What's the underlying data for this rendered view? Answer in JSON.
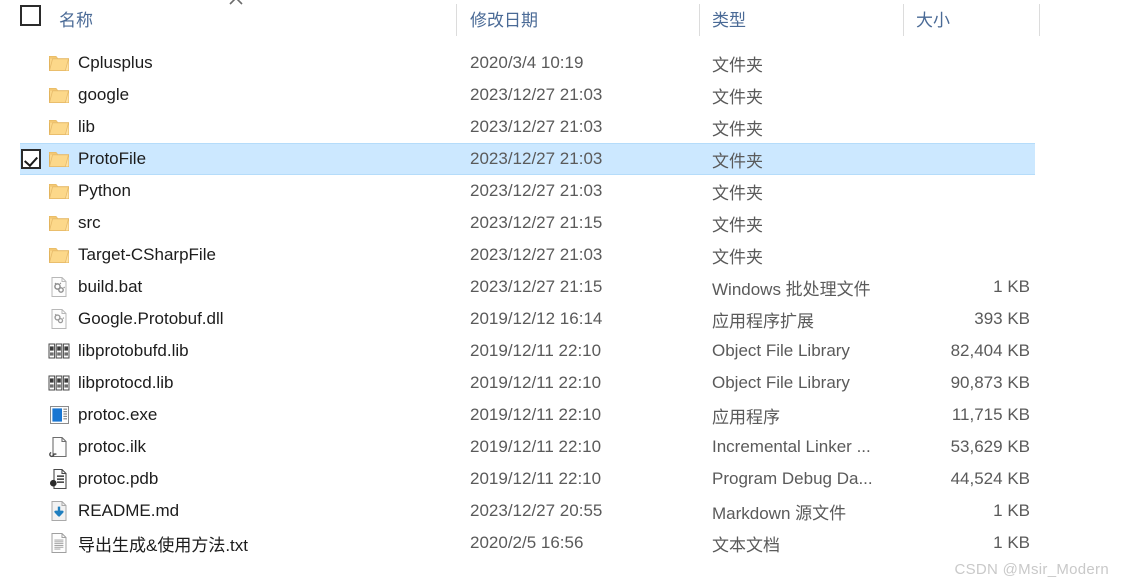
{
  "header": {
    "select_all_checkbox": false,
    "sort_indicator": "chevron-up-icon",
    "columns": [
      {
        "key": "name",
        "label": "名称"
      },
      {
        "key": "date",
        "label": "修改日期"
      },
      {
        "key": "type",
        "label": "类型"
      },
      {
        "key": "size",
        "label": "大小"
      }
    ]
  },
  "colors": {
    "selection_fill": "#cce8ff",
    "selection_border": "#b5dcfa",
    "header_text": "#4a6a96",
    "folder": "#f7d08a",
    "watermark": "#c9c9c9"
  },
  "rows": [
    {
      "name": "Cplusplus",
      "date": "2020/3/4 10:19",
      "type": "文件夹",
      "size": "",
      "icon": "folder-icon",
      "selected": false,
      "checked": false
    },
    {
      "name": "google",
      "date": "2023/12/27 21:03",
      "type": "文件夹",
      "size": "",
      "icon": "folder-icon",
      "selected": false,
      "checked": false
    },
    {
      "name": "lib",
      "date": "2023/12/27 21:03",
      "type": "文件夹",
      "size": "",
      "icon": "folder-icon",
      "selected": false,
      "checked": false
    },
    {
      "name": "ProtoFile",
      "date": "2023/12/27 21:03",
      "type": "文件夹",
      "size": "",
      "icon": "folder-icon",
      "selected": true,
      "checked": true
    },
    {
      "name": "Python",
      "date": "2023/12/27 21:03",
      "type": "文件夹",
      "size": "",
      "icon": "folder-icon",
      "selected": false,
      "checked": false
    },
    {
      "name": "src",
      "date": "2023/12/27 21:15",
      "type": "文件夹",
      "size": "",
      "icon": "folder-icon",
      "selected": false,
      "checked": false
    },
    {
      "name": "Target-CSharpFile",
      "date": "2023/12/27 21:03",
      "type": "文件夹",
      "size": "",
      "icon": "folder-icon",
      "selected": false,
      "checked": false
    },
    {
      "name": "build.bat",
      "date": "2023/12/27 21:15",
      "type": "Windows 批处理文件",
      "size": "1 KB",
      "icon": "batch-file-icon",
      "selected": false,
      "checked": false
    },
    {
      "name": "Google.Protobuf.dll",
      "date": "2019/12/12 16:14",
      "type": "应用程序扩展",
      "size": "393 KB",
      "icon": "dll-file-icon",
      "selected": false,
      "checked": false
    },
    {
      "name": "libprotobufd.lib",
      "date": "2019/12/11 22:10",
      "type": "Object File Library",
      "size": "82,404 KB",
      "icon": "library-file-icon",
      "selected": false,
      "checked": false
    },
    {
      "name": "libprotocd.lib",
      "date": "2019/12/11 22:10",
      "type": "Object File Library",
      "size": "90,873 KB",
      "icon": "library-file-icon",
      "selected": false,
      "checked": false
    },
    {
      "name": "protoc.exe",
      "date": "2019/12/11 22:10",
      "type": "应用程序",
      "size": "11,715 KB",
      "icon": "application-icon",
      "selected": false,
      "checked": false
    },
    {
      "name": "protoc.ilk",
      "date": "2019/12/11 22:10",
      "type": "Incremental Linker ...",
      "size": "53,629 KB",
      "icon": "ilk-file-icon",
      "selected": false,
      "checked": false
    },
    {
      "name": "protoc.pdb",
      "date": "2019/12/11 22:10",
      "type": "Program Debug Da...",
      "size": "44,524 KB",
      "icon": "pdb-file-icon",
      "selected": false,
      "checked": false
    },
    {
      "name": "README.md",
      "date": "2023/12/27 20:55",
      "type": "Markdown 源文件",
      "size": "1 KB",
      "icon": "markdown-file-icon",
      "selected": false,
      "checked": false
    },
    {
      "name": "导出生成&使用方法.txt",
      "date": "2020/2/5 16:56",
      "type": "文本文档",
      "size": "1 KB",
      "icon": "text-file-icon",
      "selected": false,
      "checked": false
    }
  ],
  "watermark": {
    "text": "CSDN @Msir_Modern"
  }
}
